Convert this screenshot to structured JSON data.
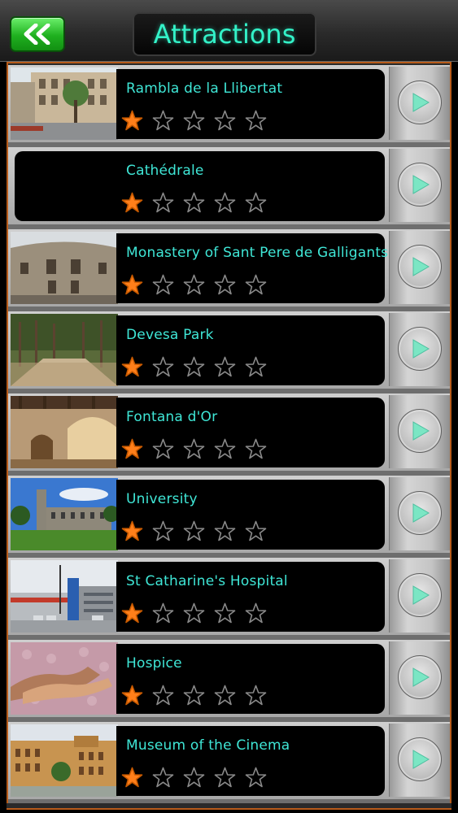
{
  "header": {
    "title": "Attractions",
    "back_icon": "double-chevron-left-icon"
  },
  "colors": {
    "accent_text": "#3fe6d6",
    "star_filled": "#ff7f1a",
    "back_button": "#1fb01f",
    "frame_border": "#b85b1a"
  },
  "attractions": [
    {
      "name": "Rambla de la Llibertat",
      "rating": 1,
      "max_rating": 5
    },
    {
      "name": "Cathédrale",
      "rating": 1,
      "max_rating": 5
    },
    {
      "name": "Monastery of Sant Pere de Galligants",
      "rating": 1,
      "max_rating": 5
    },
    {
      "name": "Devesa Park",
      "rating": 1,
      "max_rating": 5
    },
    {
      "name": "Fontana d'Or",
      "rating": 1,
      "max_rating": 5
    },
    {
      "name": "University",
      "rating": 1,
      "max_rating": 5
    },
    {
      "name": "St Catharine's Hospital",
      "rating": 1,
      "max_rating": 5
    },
    {
      "name": "Hospice",
      "rating": 1,
      "max_rating": 5
    },
    {
      "name": "Museum of the Cinema",
      "rating": 1,
      "max_rating": 5
    }
  ]
}
